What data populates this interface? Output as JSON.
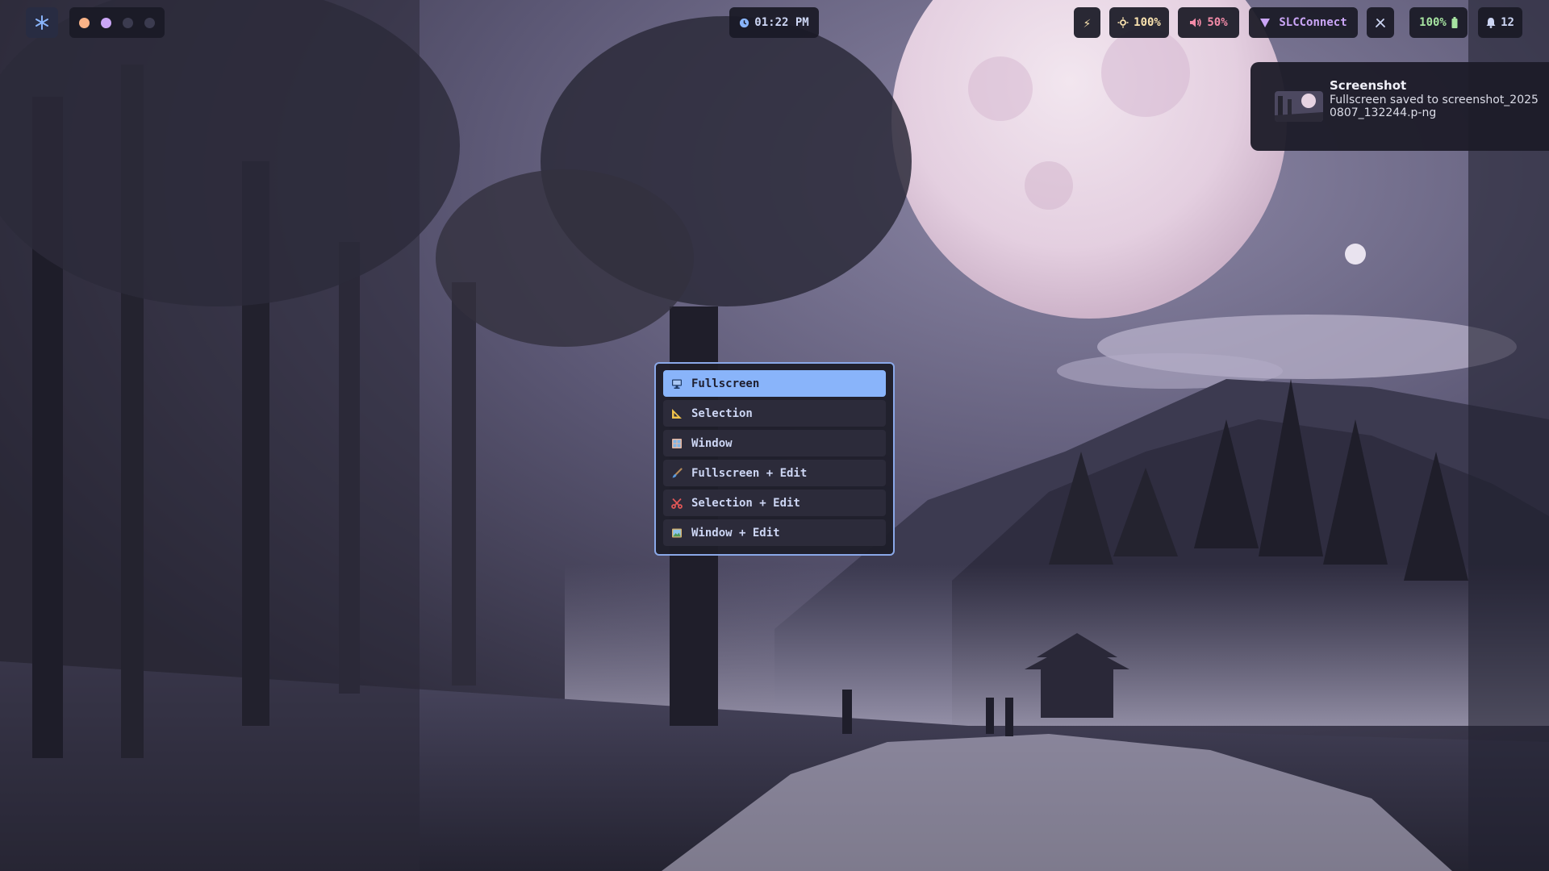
{
  "topbar": {
    "clock": "01:22 PM",
    "brightness": "100%",
    "volume": "50%",
    "vpn": "SLCConnect",
    "battery": "100%",
    "notifications_count": "12",
    "workspaces": [
      {
        "color": "#fab387",
        "state": "active"
      },
      {
        "color": "#cba6f7",
        "state": "occupied"
      },
      {
        "color": "#45475a",
        "state": "empty"
      },
      {
        "color": "#45475a",
        "state": "empty"
      }
    ],
    "accent": "#89b4fa",
    "battery_color": "#a6e3a1",
    "vpn_color": "#cba6f7",
    "volume_color": "#f38ba8",
    "brightness_color": "#f9e2af"
  },
  "notification": {
    "title": "Screenshot",
    "body": "Fullscreen saved to screenshot_20250807_132244.p-ng"
  },
  "menu": {
    "items": [
      {
        "label": "Fullscreen",
        "icon": "monitor-icon",
        "selected": true
      },
      {
        "label": "Selection",
        "icon": "ruler-icon"
      },
      {
        "label": "Window",
        "icon": "window-icon"
      },
      {
        "label": "Fullscreen + Edit",
        "icon": "paintbrush-icon"
      },
      {
        "label": "Selection + Edit",
        "icon": "scissors-icon"
      },
      {
        "label": "Window + Edit",
        "icon": "picture-icon"
      }
    ]
  }
}
